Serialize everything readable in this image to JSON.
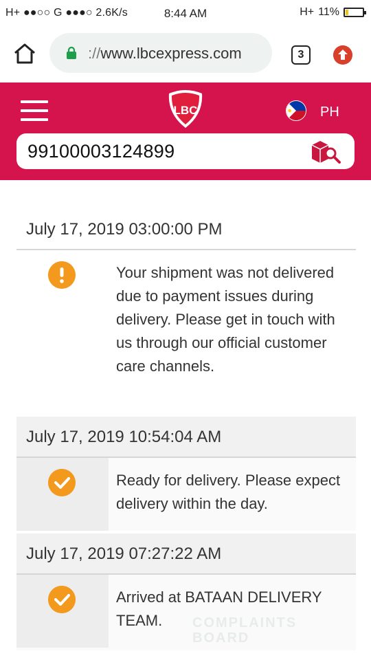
{
  "status_bar": {
    "left": "H+ ●●○○ G ●●●○ 2.6K/s",
    "time": "8:44 AM",
    "net": "H+",
    "battery": "11%"
  },
  "browser": {
    "url_scheme": "://",
    "url_host": "www.lbcexpress.com",
    "tab_count": "3"
  },
  "header": {
    "logo_text": "LBC",
    "country": "PH",
    "search_value": "99100003124899"
  },
  "timeline": [
    {
      "date": "July 17, 2019 03:00:00 PM",
      "status": "warning",
      "icon": "alert-icon",
      "message": "Your shipment was not delivered due to payment issues during delivery. Please get in touch with us through our official customer care channels."
    },
    {
      "date": "July 17, 2019 10:54:04 AM",
      "status": "done",
      "icon": "check-icon",
      "message": "Ready for delivery. Please expect delivery within the day."
    },
    {
      "date": "July 17, 2019 07:27:22 AM",
      "status": "done",
      "icon": "check-icon",
      "message": "Arrived at BATAAN DELIVERY TEAM."
    }
  ],
  "watermark": "COMPLAINTS BOARD",
  "colors": {
    "brand": "#d5134c",
    "status_icon": "#f39a1e"
  }
}
